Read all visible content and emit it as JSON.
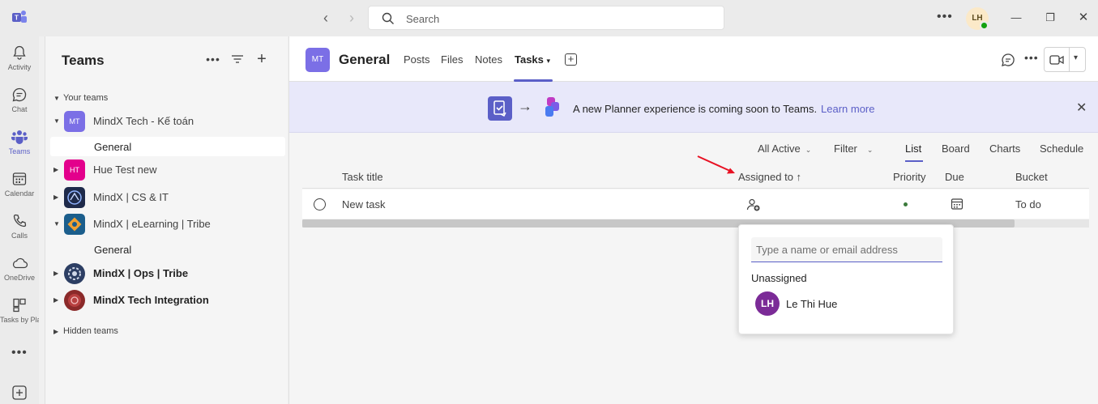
{
  "titlebar": {
    "search_placeholder": "Search",
    "more_label": "•••",
    "avatar_initials": "LH",
    "minimize": "—",
    "maximize": "❐",
    "close": "✕"
  },
  "rail": {
    "items": [
      {
        "label": "Activity",
        "icon": "bell-icon"
      },
      {
        "label": "Chat",
        "icon": "chat-icon"
      },
      {
        "label": "Teams",
        "icon": "teams-icon",
        "active": true
      },
      {
        "label": "Calendar",
        "icon": "calendar-icon"
      },
      {
        "label": "Calls",
        "icon": "phone-icon"
      },
      {
        "label": "OneDrive",
        "icon": "cloud-icon"
      },
      {
        "label": "Tasks by Pla...",
        "icon": "tasks-icon"
      }
    ],
    "more_label": "•••"
  },
  "teams_panel": {
    "title": "Teams",
    "more_label": "•••",
    "your_teams": "Your teams",
    "hidden_teams": "Hidden teams",
    "teams": [
      {
        "name": "MindX Tech - Kế toán",
        "initials": "MT",
        "color": "#7b6fe6",
        "bold": false,
        "channels": [
          "General"
        ]
      },
      {
        "name": "Hue Test new",
        "initials": "HT",
        "color": "#e3008c",
        "bold": false,
        "channels": []
      },
      {
        "name": "MindX | CS & IT",
        "initials": "",
        "color": "#1e2a4a",
        "bold": false,
        "channels": []
      },
      {
        "name": "MindX | eLearning | Tribe",
        "initials": "",
        "color": "#1b5e8c",
        "bold": false,
        "channels": [
          "General"
        ]
      },
      {
        "name": "MindX | Ops | Tribe",
        "initials": "",
        "color": "#2c3e63",
        "bold": true,
        "channels": []
      },
      {
        "name": "MindX Tech Integration",
        "initials": "",
        "color": "#8b2a2a",
        "bold": true,
        "channels": []
      }
    ]
  },
  "channel": {
    "avatar_initials": "MT",
    "title": "General",
    "tabs": [
      "Posts",
      "Files",
      "Notes",
      "Tasks"
    ],
    "active_tab": "Tasks",
    "more_label": "•••"
  },
  "banner": {
    "text": "A new Planner experience is coming soon to Teams.",
    "link": "Learn more",
    "close": "✕"
  },
  "toolbar": {
    "all_active": "All Active",
    "filter": "Filter",
    "views": [
      "List",
      "Board",
      "Charts",
      "Schedule"
    ],
    "active_view": "List"
  },
  "grid": {
    "columns": [
      "Task title",
      "Assigned to ↑",
      "Priority",
      "Due",
      "Bucket"
    ],
    "rows": [
      {
        "title": "New task",
        "bucket": "To do"
      }
    ]
  },
  "assign_popup": {
    "placeholder": "Type a name or email address",
    "unassigned": "Unassigned",
    "users": [
      {
        "initials": "LH",
        "name": "Le Thi Hue"
      }
    ]
  },
  "colors": {
    "accent": "#5b5fc7",
    "annotation": "#e81123"
  }
}
